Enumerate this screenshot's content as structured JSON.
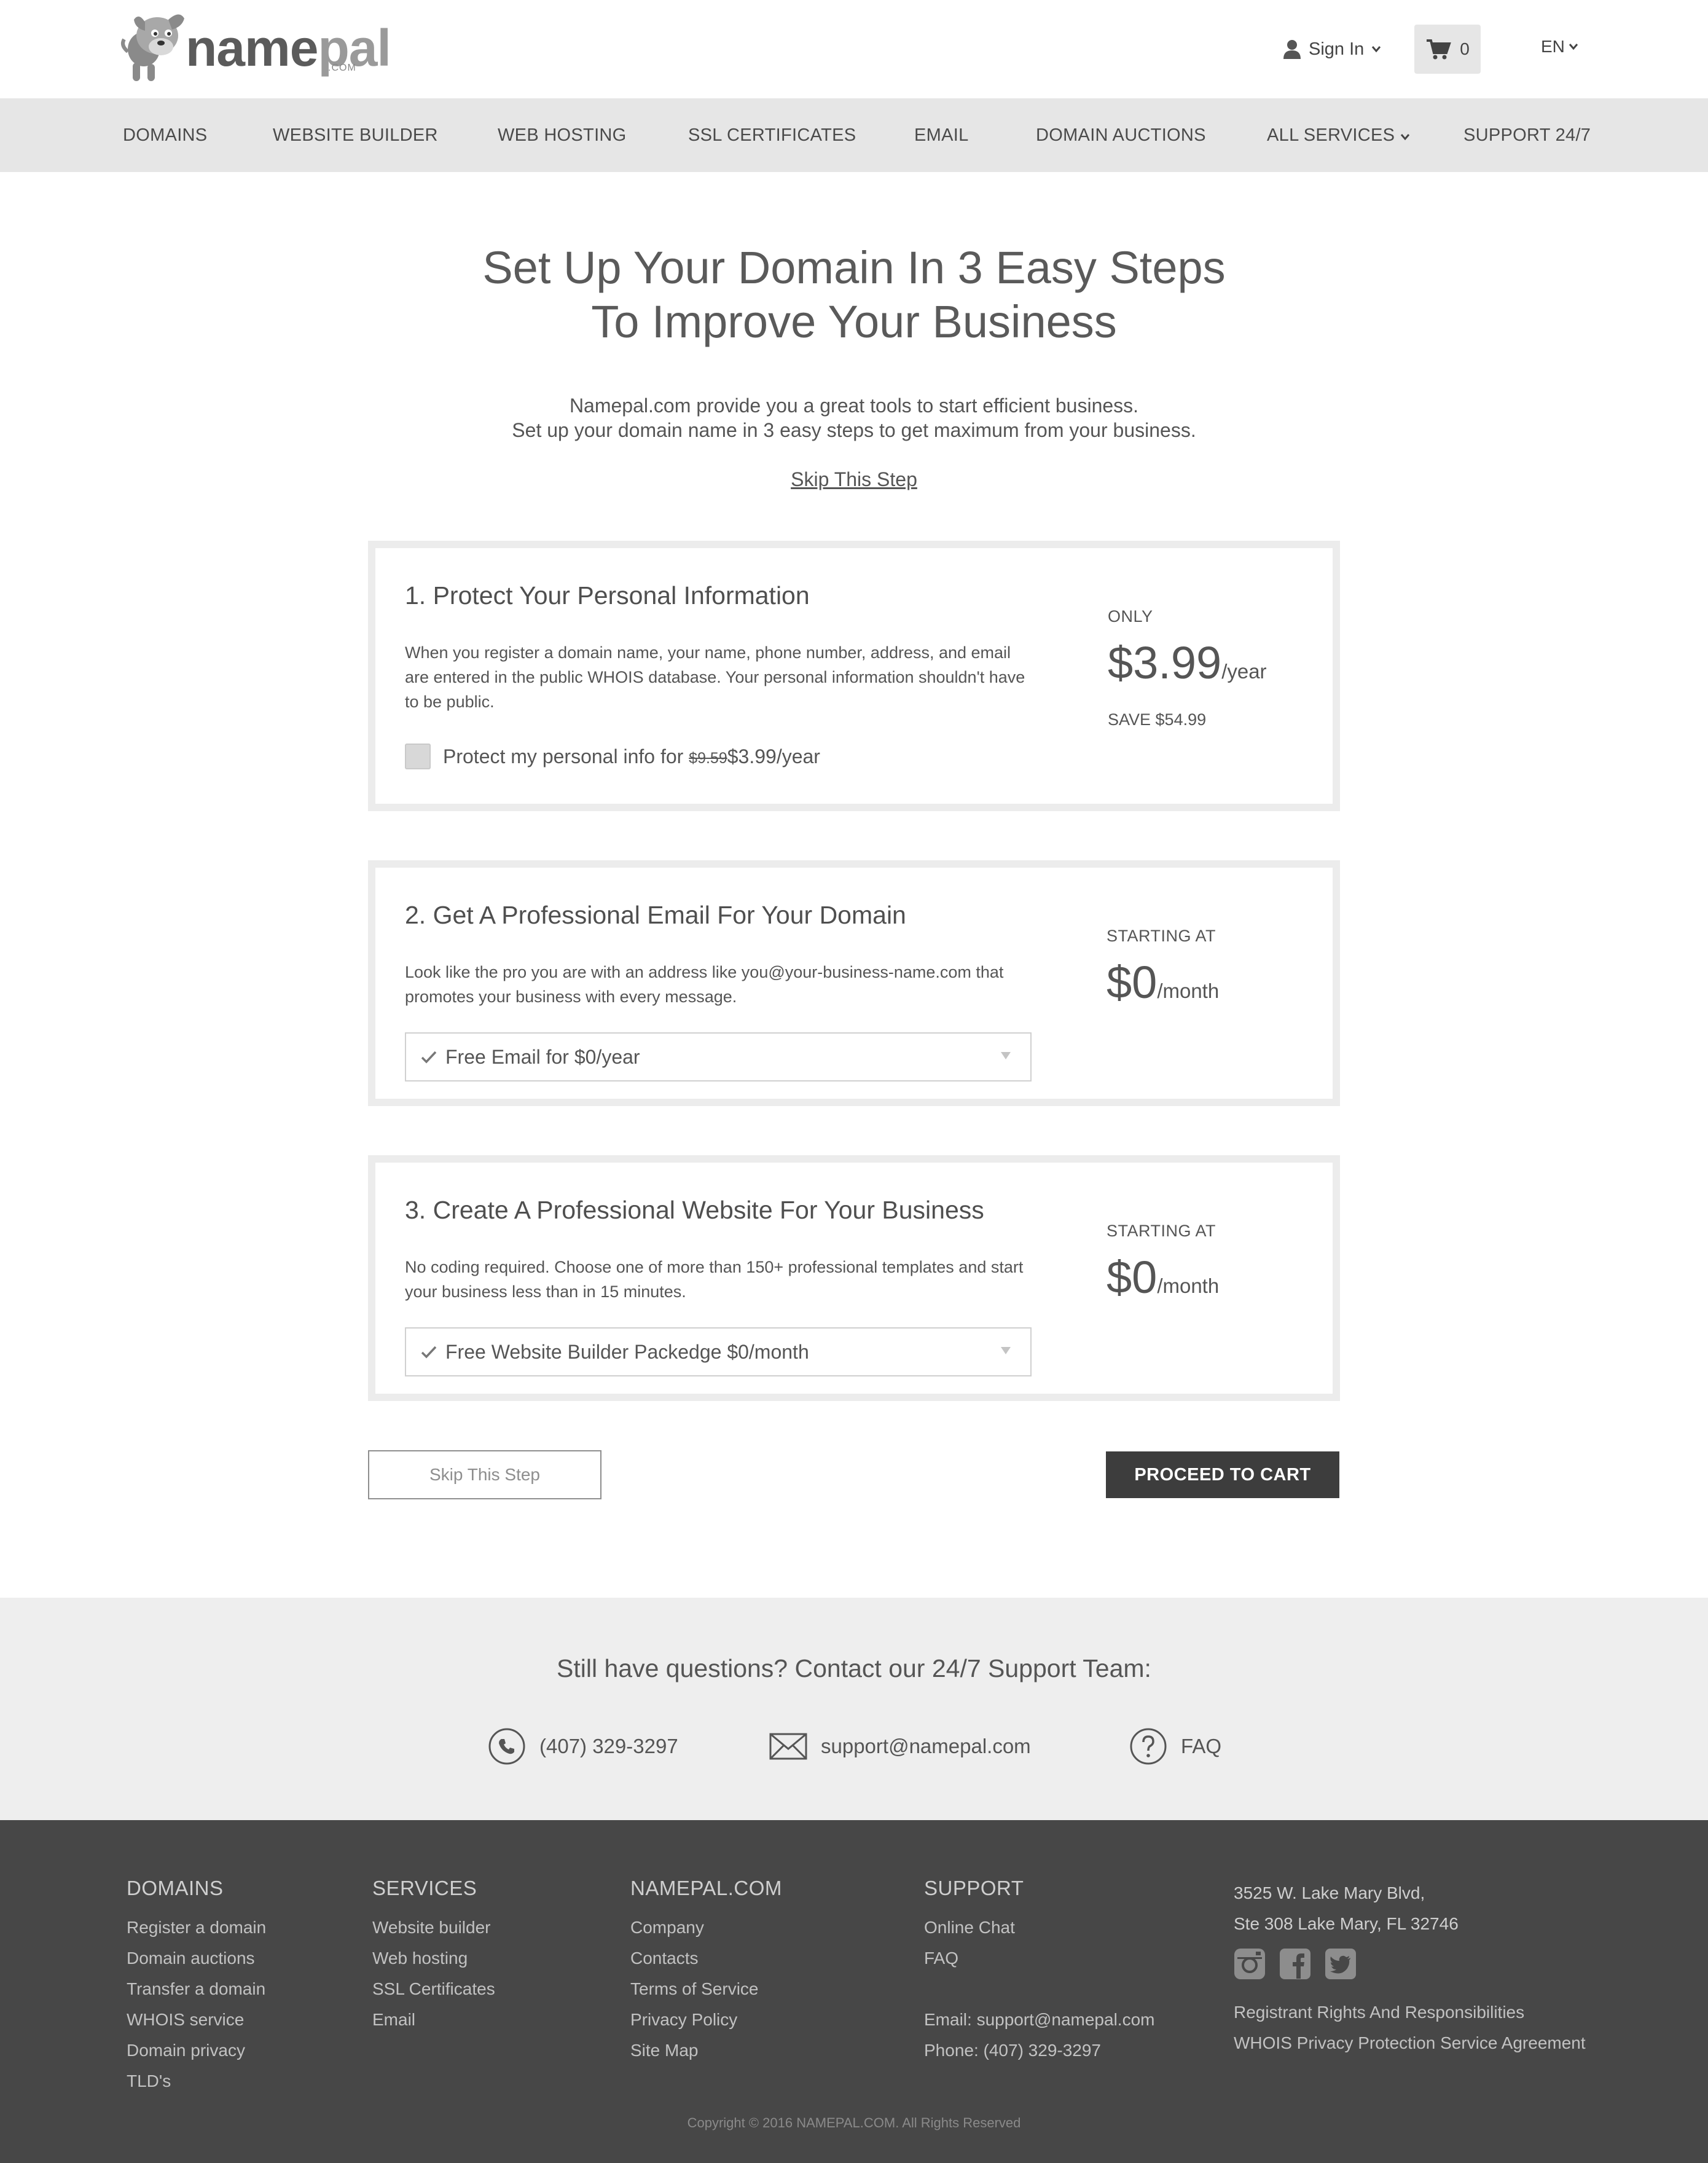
{
  "header": {
    "logo_primary": "name",
    "logo_secondary": "pal",
    "logo_suffix": ".COM",
    "sign_in": "Sign In",
    "cart_count": "0",
    "language": "EN"
  },
  "nav": {
    "items": [
      "DOMAINS",
      "WEBSITE BUILDER",
      "WEB HOSTING",
      "SSL CERTIFICATES",
      "EMAIL",
      "DOMAIN AUCTIONS",
      "ALL SERVICES",
      "SUPPORT 24/7"
    ]
  },
  "hero": {
    "title_line1": "Set Up Your Domain In 3 Easy Steps",
    "title_line2": "To Improve Your Business",
    "sub_line1": "Namepal.com provide you a great tools to start efficient business.",
    "sub_line2": "Set up your domain name in 3 easy steps to get maximum from your business.",
    "skip": "Skip This Step"
  },
  "steps": [
    {
      "title": "1. Protect Your Personal Information",
      "description": "When you register a domain name, your name, phone number, address, and email are entered in the public WHOIS database. Your personal information shouldn't have to be public.",
      "price_label": "ONLY",
      "price": "$3.99",
      "price_unit": "/year",
      "save": "SAVE $54.99",
      "checkbox_label": "Protect my personal info for",
      "old_price": "$9.59",
      "new_price": "$3.99/year",
      "checked": false
    },
    {
      "title": "2. Get A Professional Email For Your Domain",
      "description": "Look like the pro you are with an address like you@your-business-name.com that promotes your business with every message.",
      "price_label": "STARTING AT",
      "price": "$0",
      "price_unit": "/month",
      "selected_option": "Free Email for $0/year"
    },
    {
      "title": "3. Create A Professional Website For Your Business",
      "description": "No coding required. Choose one of more than 150+ professional templates and start your business less than in 15 minutes.",
      "price_label": "STARTING AT",
      "price": "$0",
      "price_unit": "/month",
      "selected_option": "Free Website Builder Packedge $0/month"
    }
  ],
  "actions": {
    "skip": "Skip This Step",
    "proceed": "PROCEED TO CART"
  },
  "support": {
    "title": "Still have questions? Contact our 24/7 Support Team:",
    "phone": "(407) 329-3297",
    "email": "support@namepal.com",
    "faq": "FAQ"
  },
  "footer": {
    "columns": [
      {
        "heading": "DOMAINS",
        "links": [
          "Register a domain",
          "Domain auctions",
          "Transfer a domain",
          "WHOIS service",
          "Domain privacy",
          "TLD's"
        ]
      },
      {
        "heading": "SERVICES",
        "links": [
          "Website builder",
          "Web hosting",
          "SSL Certificates",
          "Email"
        ]
      },
      {
        "heading": "NAMEPAL.COM",
        "links": [
          "Company",
          "Contacts",
          "Terms of Service",
          "Privacy Policy",
          "Site Map"
        ]
      },
      {
        "heading": "SUPPORT",
        "links": [
          "Online Chat",
          "FAQ"
        ],
        "contact": [
          "Email: support@namepal.com",
          "Phone: (407) 329-3297"
        ]
      }
    ],
    "address_line1": "3525 W. Lake Mary Blvd,",
    "address_line2": "Ste 308 Lake Mary, FL 32746",
    "social_icons": [
      "instagram-icon",
      "facebook-icon",
      "twitter-icon"
    ],
    "legal_links": [
      "Registrant Rights And Responsibilities",
      "WHOIS Privacy Protection Service Agreement"
    ],
    "copyright": "Copyright © 2016 NAMEPAL.COM. All Rights Reserved"
  },
  "colors": {
    "nav_bg": "#e6e6e6",
    "card_border": "#ececec",
    "button_dark": "#3d3d3d",
    "support_bg": "#eeeeee",
    "footer_bg": "#474747"
  }
}
